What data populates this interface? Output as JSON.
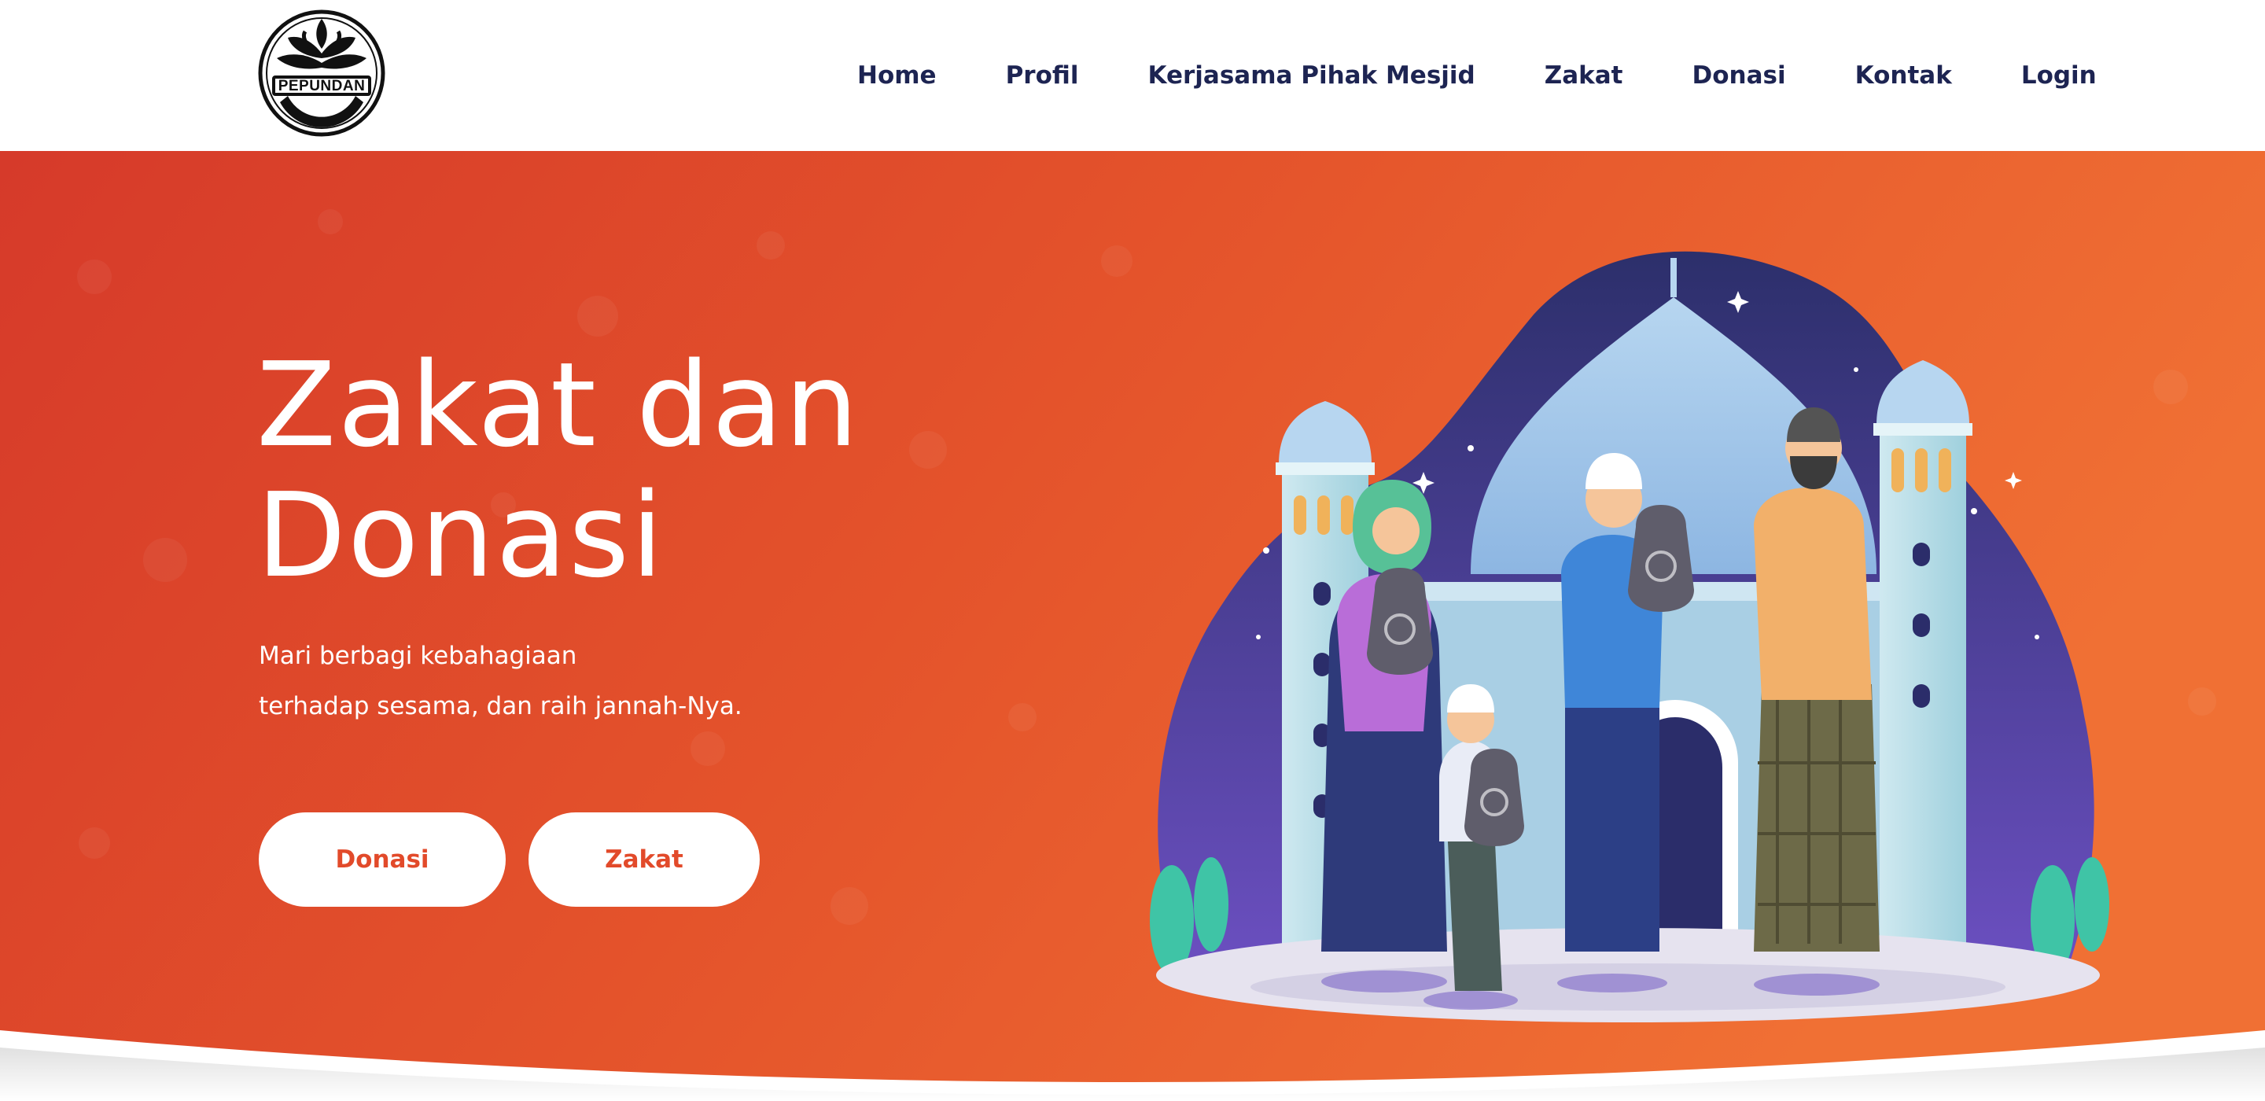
{
  "brand": {
    "logo_text": "PEPUNDAN",
    "colors": {
      "nav_text": "#1d2452",
      "hero_start": "#d8402a",
      "hero_end": "#ef6f33",
      "button_text": "#e24a2a"
    }
  },
  "nav": {
    "items": [
      {
        "label": "Home"
      },
      {
        "label": "Profil"
      },
      {
        "label": "Kerjasama Pihak Mesjid"
      },
      {
        "label": "Zakat"
      },
      {
        "label": "Donasi"
      },
      {
        "label": "Kontak"
      },
      {
        "label": "Login"
      }
    ]
  },
  "hero": {
    "title_line1": "Zakat dan",
    "title_line2": "Donasi",
    "subtitle_line1": "Mari berbagi kebahagiaan",
    "subtitle_line2": "terhadap sesama, dan raih jannah-Nya.",
    "buttons": {
      "donasi": "Donasi",
      "zakat": "Zakat"
    },
    "illustration_icon": "mosque-giving-illustration"
  }
}
